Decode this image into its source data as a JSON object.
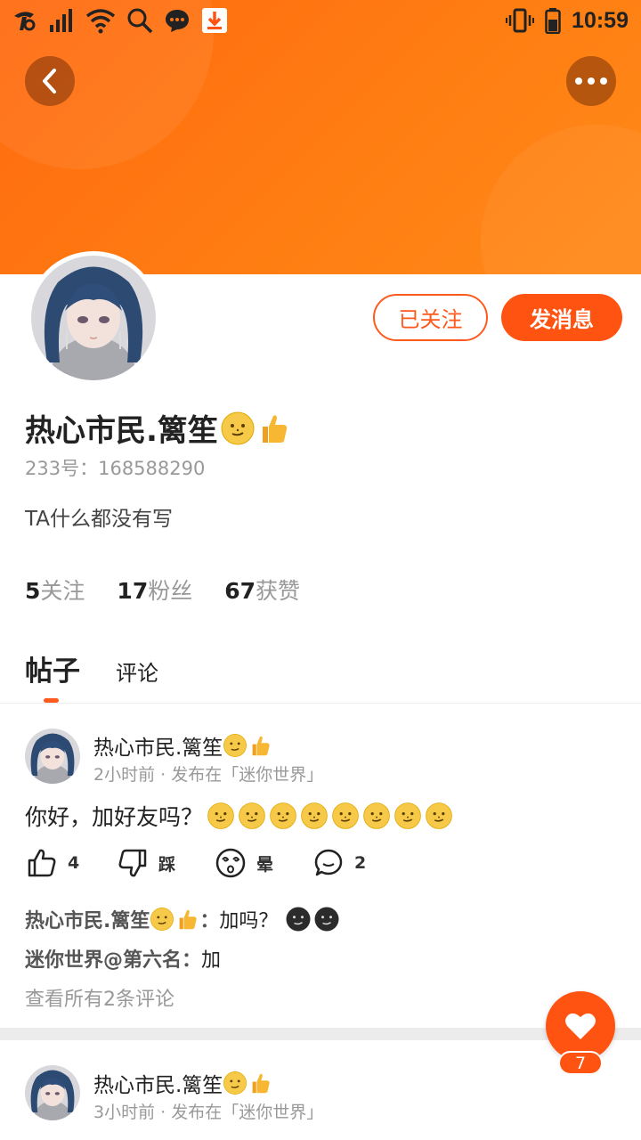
{
  "status_bar": {
    "time": "10:59",
    "icons": [
      "china-telecom-icon",
      "signal-icon",
      "wifi-icon",
      "search-icon",
      "chat-icon",
      "download-icon",
      "vibrate-icon",
      "battery-icon"
    ]
  },
  "header": {
    "back_icon": "back-chevron-icon",
    "more_icon": "more-dots-icon",
    "gradient": [
      "#ff6a10",
      "#ff8a1a"
    ]
  },
  "profile": {
    "name": "热心市民.篱笙",
    "name_emojis": [
      "smirk-face-icon",
      "thumbs-up-icon"
    ],
    "uid_label": "233号：",
    "uid": "168588290",
    "bio": "TA什么都没有写",
    "follow_button": "已关注",
    "message_button": "发消息",
    "stats": [
      {
        "value": "5",
        "label": "关注"
      },
      {
        "value": "17",
        "label": "粉丝"
      },
      {
        "value": "67",
        "label": "获赞"
      }
    ]
  },
  "tabs": {
    "posts": "帖子",
    "comments": "评论",
    "active": "帖子"
  },
  "posts": [
    {
      "author": "热心市民.篱笙",
      "time": "2小时前",
      "published_prefix": "·",
      "published_in": "发布在「迷你世界」",
      "content": "你好，加好友吗？",
      "content_emoji_count": 8,
      "likes": "4",
      "dislike_label": "踩",
      "dizzy_label": "晕",
      "comments_count": "2",
      "comments": [
        {
          "author": "热心市民.篱笙",
          "sep": "：",
          "text": "加吗？"
        },
        {
          "author": "迷你世界@第六名",
          "sep": "：",
          "text": "加"
        }
      ],
      "view_all": "查看所有2条评论"
    },
    {
      "author": "热心市民.篱笙",
      "time": "3小时前",
      "published_prefix": "·",
      "published_in": "发布在「迷你世界」"
    }
  ],
  "fab": {
    "icon": "heart-icon",
    "count": "7"
  },
  "colors": {
    "accent": "#ff5312",
    "text": "#222222",
    "muted": "#999999"
  }
}
